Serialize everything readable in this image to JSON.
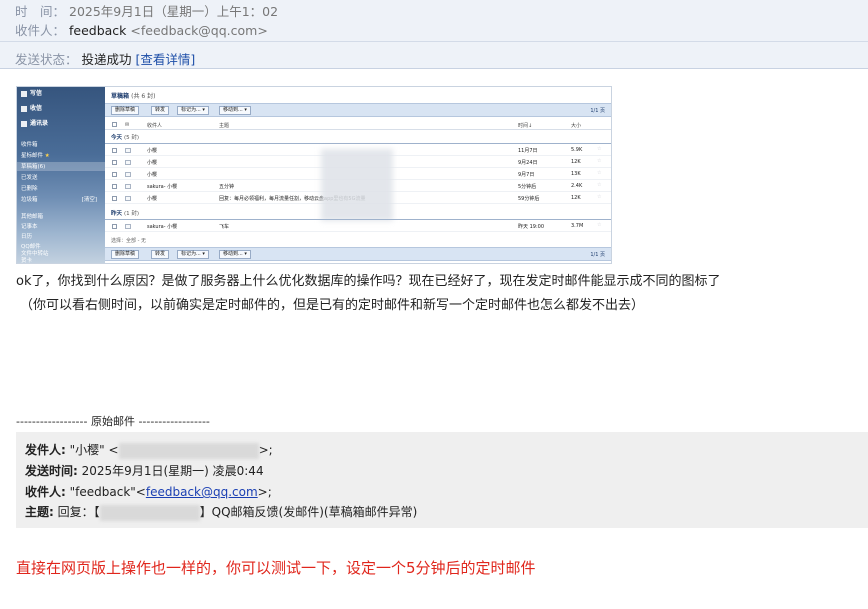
{
  "header": {
    "time_label": "时　间：",
    "time_value": "2025年9月1日（星期一）上午1：02",
    "to_label": "收件人：",
    "to_name": "feedback",
    "to_email": "<feedback@qq.com>",
    "status_label": "发送状态：",
    "status_value": "投递成功",
    "status_link": "[查看详情]"
  },
  "screenshot": {
    "sidebar": {
      "items": [
        "写信",
        "收信",
        "通讯录",
        "收件箱",
        "星标邮件",
        "草稿箱(6)",
        "已发送",
        "已删除",
        "垃圾箱",
        "[清空]",
        "其他邮箱",
        "记事本",
        "日历",
        "QQ邮件",
        "文件中转站",
        "贺卡",
        "阅读空间"
      ]
    },
    "folder_title": "草稿箱",
    "folder_count": "(共 6 封)",
    "toolbar": {
      "delete": "删除草稿",
      "forward": "转发",
      "mark": "标记为... ▾",
      "move": "移动到... ▾",
      "page": "1/1 页"
    },
    "columns": {
      "from": "收件人",
      "subject": "主题",
      "time": "时间↓",
      "size": "大小"
    },
    "groups": {
      "today": "今天",
      "today_count": "(5 封)",
      "yesterday": "昨天",
      "yesterday_count": "(1 封)"
    },
    "rows_today": [
      {
        "to": "小樱",
        "subject": "",
        "time": "11月7日",
        "size": "5.9K"
      },
      {
        "to": "小樱",
        "subject": "",
        "time": "9月24日",
        "size": "12K"
      },
      {
        "to": "小樱",
        "subject": "",
        "time": "9月7日",
        "size": "13K"
      },
      {
        "to": "sakura- 小樱",
        "subject": "五分钟",
        "time": "5分钟后",
        "size": "2.4K"
      },
      {
        "to": "小樱",
        "subject": "回复：每月必领福利，每月流量任割，移动云盘app里也有5G流量",
        "time": "59分钟后",
        "size": "12K"
      }
    ],
    "rows_yesterday": [
      {
        "to": "sakura- 小樱",
        "subject": "飞车",
        "time": "昨天 19:00",
        "size": "3.7M"
      }
    ],
    "select_line": "选择：全部 - 无"
  },
  "body": {
    "para1": "ok了，你找到什么原因？是做了服务器上什么优化数据库的操作吗？现在已经好了，现在发定时邮件能显示成不同的图标了",
    "para2": "（你可以看右侧时间，以前确实是定时邮件的，但是已有的定时邮件和新写一个定时邮件也怎么都发不出去）",
    "original_divider": "------------------ 原始邮件 ------------------"
  },
  "quoted": {
    "from_label": "发件人:",
    "from_name": "\"小樱\" <",
    "from_tail": ">;",
    "sent_label": "发送时间:",
    "sent_value": "2025年9月1日(星期一) 凌晨0:44",
    "to_label": "收件人:",
    "to_name": "\"feedback\"<",
    "to_email": "feedback@qq.com",
    "to_tail": ">;",
    "subject_label": "主题:",
    "subject_prefix": "回复：【",
    "subject_suffix": "】QQ邮箱反馈(发邮件)(草稿箱邮件异常)"
  },
  "reply_line": "直接在网页版上操作也一样的，你可以测试一下，设定一个5分钟后的定时邮件",
  "colors": {
    "header_bg": "#eef2f8",
    "link_blue": "#1a3fb3",
    "reply_red": "#e0261c",
    "quote_bg": "#efefef"
  }
}
